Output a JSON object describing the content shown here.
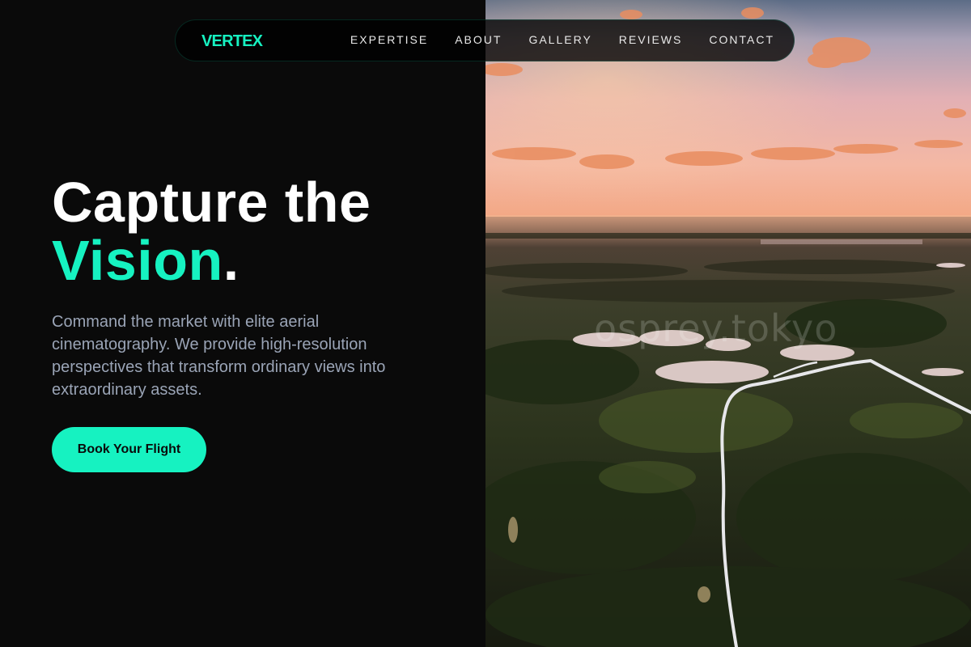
{
  "nav": {
    "logo": "VERTEX",
    "links": [
      "EXPERTISE",
      "ABOUT",
      "GALLERY",
      "REVIEWS",
      "CONTACT"
    ]
  },
  "hero": {
    "headline_line1": "Capture the",
    "headline_accent": "Vision",
    "headline_period": ".",
    "description": "Command the market with elite aerial cinematography. We provide high-resolution perspectives that transform ordinary views into extraordinary assets.",
    "cta_label": "Book Your Flight",
    "image_watermark": "osprey.tokyo"
  },
  "colors": {
    "accent": "#16f2c1",
    "background": "#0a0a0a",
    "text_primary": "#ffffff",
    "text_muted": "#9aa4b6"
  }
}
